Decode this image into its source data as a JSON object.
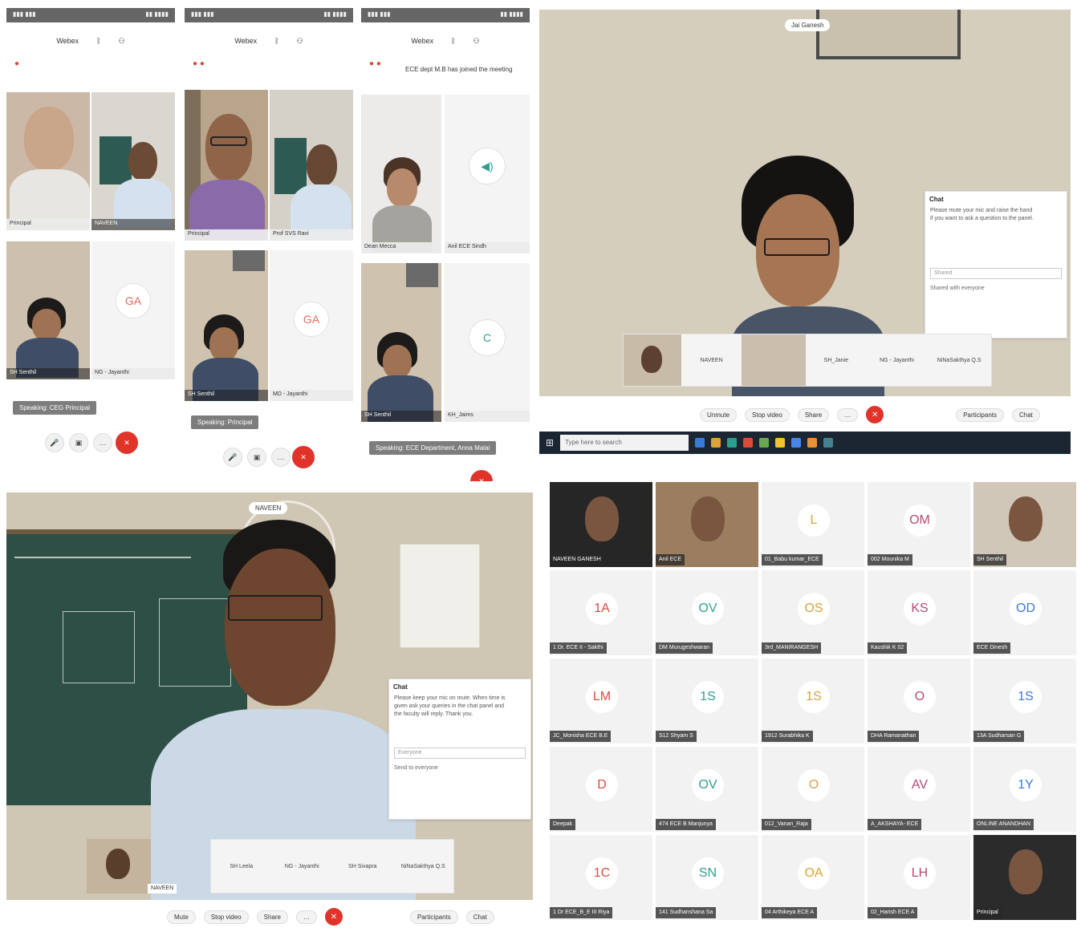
{
  "phone1": {
    "app_title": "Webex",
    "tiles": [
      "Principal",
      "NAVEEN",
      "SH Senthil",
      "NG - Jayanthi"
    ],
    "initials": "GA",
    "speaking": "Speaking: CEG Principal"
  },
  "phone2": {
    "app_title": "Webex",
    "tiles": [
      "Principal",
      "Prof SVS Ravi",
      "SH Senthil",
      "MD - Jayanthi"
    ],
    "initials": "GA",
    "speaking": "Speaking: Principal"
  },
  "phone3": {
    "app_title": "Webex",
    "notice": "ECE dept M.B has joined the meeting",
    "tiles": [
      "Dean Mecca",
      "Anil ECE Sindh",
      "SH Senthil",
      "KH_Jaims"
    ],
    "initials": "C",
    "speaking": "Speaking: ECE Department, Anna Malai"
  },
  "laptop1": {
    "top_pill": "Jai Ganesh",
    "chat_title": "Chat",
    "chat_lines": [
      "Please mute your mic and raise the hand",
      "if you want to ask a question to the panel."
    ],
    "chat_input": "Shared",
    "chat_to": "Shared with everyone",
    "strip": [
      "NAVEEN",
      "SH_Janie",
      "NG - Jayanthi",
      "NiNaSakthya Q.S"
    ],
    "toolbar": [
      "Unmute",
      "Stop video",
      "Share",
      "Participants",
      "Chat"
    ],
    "taskbar_search": "Type here to search"
  },
  "laptop2": {
    "top_pill": "NAVEEN",
    "chat_title": "Chat",
    "chat_lines": [
      "Please keep your mic on mute. When time is",
      "given ask your queries in the chat panel and",
      "the faculty will reply. Thank you."
    ],
    "chat_input": "Everyone",
    "chat_to": "Send to everyone",
    "self_label": "NAVEEN",
    "strip": [
      "SH Leela",
      "NG - Jayanthi",
      "SH Sivapra",
      "NiNaSakthya Q.S"
    ],
    "toolbar": [
      "Mute",
      "Stop video",
      "Share",
      "Participants",
      "Chat"
    ]
  },
  "grid": {
    "tiles": [
      {
        "name": "NAVEEN GANESH",
        "initials": "",
        "video": true
      },
      {
        "name": "Anil ECE",
        "initials": "",
        "video": true
      },
      {
        "name": "01_Babu kumar_ECE",
        "initials": "L",
        "video": false
      },
      {
        "name": "002 Mounika M",
        "initials": "OM",
        "video": false
      },
      {
        "name": "SH Senthil",
        "initials": "",
        "video": true
      },
      {
        "name": "1 Dr. ECE II - Sakthi",
        "initials": "1A",
        "video": false
      },
      {
        "name": "DM Murugeshwaran",
        "initials": "OV",
        "video": false
      },
      {
        "name": "3rd_MANIRANGESH",
        "initials": "OS",
        "video": false
      },
      {
        "name": "Kaushik K 02",
        "initials": "KS",
        "video": false
      },
      {
        "name": "ECE Dinesh",
        "initials": "OD",
        "video": false
      },
      {
        "name": "JC_Monisha ECE B.E",
        "initials": "LM",
        "video": false
      },
      {
        "name": "S12 Shyam S",
        "initials": "1S",
        "video": false
      },
      {
        "name": "1912 Surabhika K",
        "initials": "1S",
        "video": false
      },
      {
        "name": "DHA Ramanathan",
        "initials": "O",
        "video": false
      },
      {
        "name": "13A Sudharsan G",
        "initials": "1S",
        "video": false
      },
      {
        "name": "Deepak",
        "initials": "D",
        "video": false
      },
      {
        "name": "474 ECE B Manjunya",
        "initials": "OV",
        "video": false
      },
      {
        "name": "012_Vanan_Raja",
        "initials": "O",
        "video": false
      },
      {
        "name": "A_AKSHAYA- ECE",
        "initials": "AV",
        "video": false
      },
      {
        "name": "ONLINE ANANDHAN",
        "initials": "1Y",
        "video": false
      },
      {
        "name": "1 Dr ECE_B_E III Riya",
        "initials": "1C",
        "video": false
      },
      {
        "name": "141 Sudhanshana Sa",
        "initials": "SN",
        "video": false
      },
      {
        "name": "04 Arthikeya ECE A",
        "initials": "OA",
        "video": false
      },
      {
        "name": "02_Harish ECE A",
        "initials": "LH",
        "video": false
      },
      {
        "name": "Principal",
        "initials": "",
        "video": true
      }
    ]
  },
  "colors": {
    "end_call": "#e0332a",
    "initials_palette": [
      "#d94c3c",
      "#2e9e8f",
      "#d9a23c",
      "#b24c6a",
      "#3c7ad9"
    ]
  }
}
